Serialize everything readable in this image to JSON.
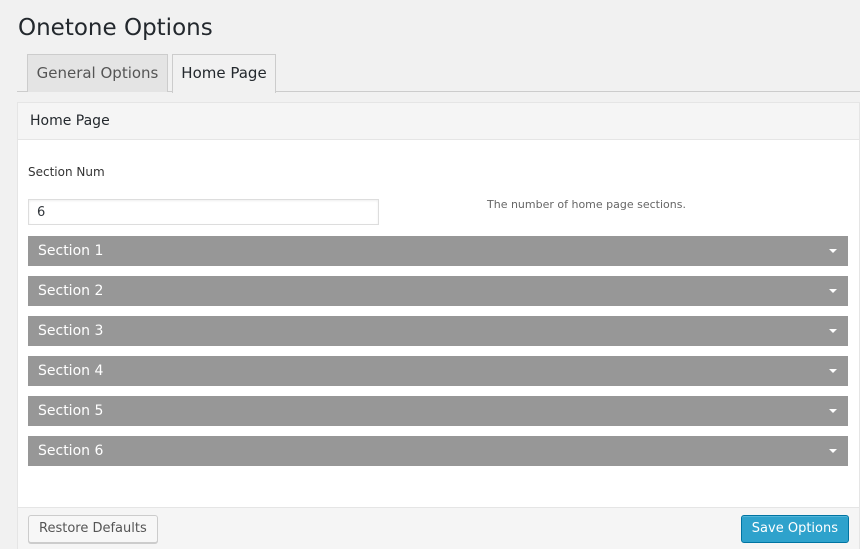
{
  "page": {
    "title": "Onetone Options"
  },
  "tabs": [
    {
      "label": "General Options",
      "active": false
    },
    {
      "label": "Home Page",
      "active": true
    }
  ],
  "panel": {
    "header": "Home Page",
    "section_num": {
      "label": "Section Num",
      "value": "6",
      "description": "The number of home page sections."
    },
    "sections": [
      "Section 1",
      "Section 2",
      "Section 3",
      "Section 4",
      "Section 5",
      "Section 6"
    ]
  },
  "footer": {
    "restore_label": "Restore Defaults",
    "save_label": "Save Options"
  },
  "icons": {
    "section_toggle": "caret-down-icon"
  },
  "colors": {
    "section_bar": "#979797",
    "save_button": "#2ea2cc",
    "background": "#f1f1f1"
  }
}
